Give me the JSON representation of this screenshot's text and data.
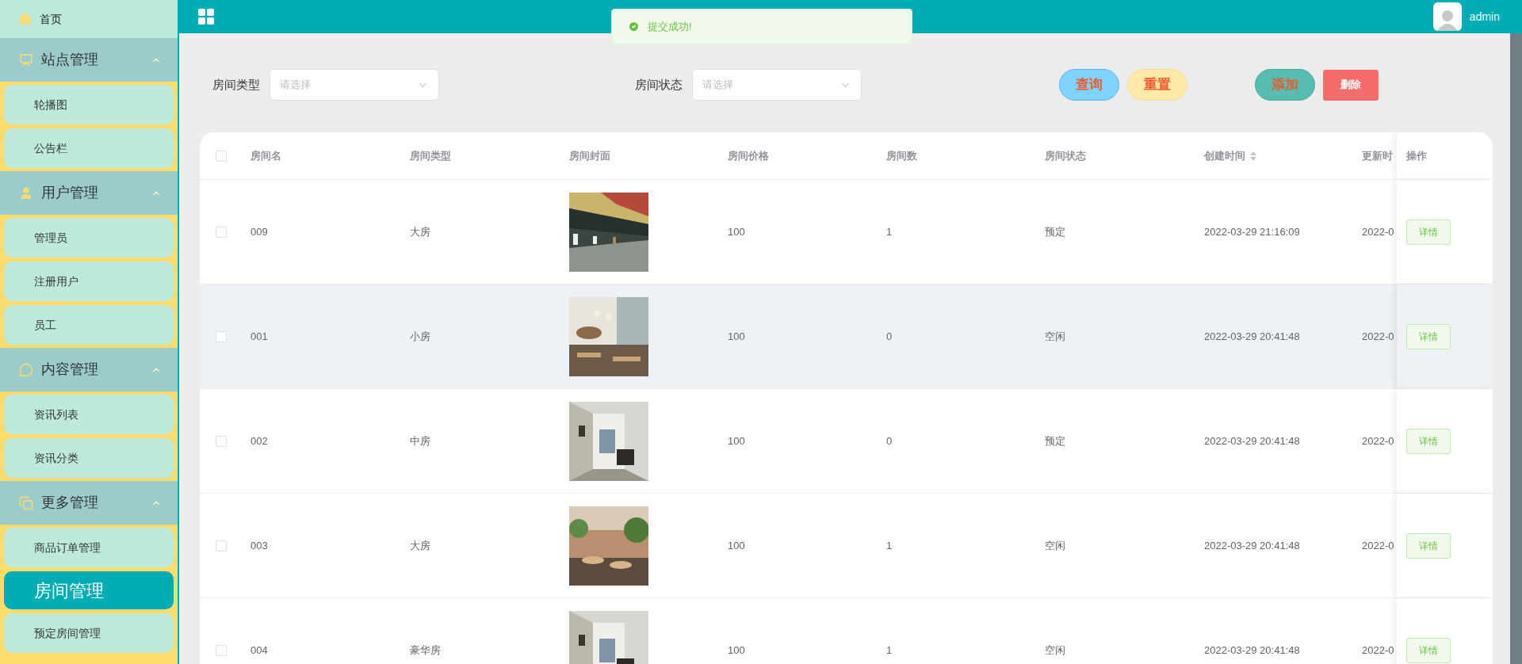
{
  "sidebar": {
    "home": {
      "label": "首页",
      "selected": false
    },
    "groups": [
      {
        "label": "站点管理",
        "expanded": true,
        "items": [
          {
            "label": "轮播图",
            "selected": false
          },
          {
            "label": "公告栏",
            "selected": false
          }
        ]
      },
      {
        "label": "用户管理",
        "expanded": true,
        "items": [
          {
            "label": "管理员",
            "selected": false
          },
          {
            "label": "注册用户",
            "selected": false
          },
          {
            "label": "员工",
            "selected": false
          }
        ]
      },
      {
        "label": "内容管理",
        "expanded": true,
        "items": [
          {
            "label": "资讯列表",
            "selected": false
          },
          {
            "label": "资讯分类",
            "selected": false
          }
        ]
      },
      {
        "label": "更多管理",
        "expanded": true,
        "items": [
          {
            "label": "商品订单管理",
            "selected": false
          },
          {
            "label": "房间管理",
            "selected": true
          },
          {
            "label": "预定房间管理",
            "selected": false
          }
        ]
      }
    ]
  },
  "header": {
    "user": "admin"
  },
  "toast": {
    "message": "提交成功!"
  },
  "filters": [
    {
      "label": "房间类型",
      "placeholder": "请选择"
    },
    {
      "label": "房间状态",
      "placeholder": "请选择"
    }
  ],
  "buttons": [
    {
      "label": "查询",
      "kind": "query"
    },
    {
      "label": "重置",
      "kind": "reset"
    },
    {
      "label": "添加",
      "kind": "add"
    },
    {
      "label": "删除",
      "kind": "delete"
    }
  ],
  "table": {
    "select_all": {
      "checked": false
    },
    "columns": [
      {
        "label": "房间名",
        "sortable": false
      },
      {
        "label": "房间类型",
        "sortable": false
      },
      {
        "label": "房间封面",
        "sortable": false
      },
      {
        "label": "房间价格",
        "sortable": false
      },
      {
        "label": "房间数",
        "sortable": false
      },
      {
        "label": "房间状态",
        "sortable": false
      },
      {
        "label": "创建时间",
        "sortable": true
      },
      {
        "label": "更新时",
        "sortable": false
      }
    ],
    "action_column": "操作",
    "rows": [
      {
        "checked": false,
        "hovered": false,
        "name": "009",
        "type": "大房",
        "price": "100",
        "count": "1",
        "status": "预定",
        "created": "2022-03-29 21:16:09",
        "updated": "2022-0",
        "action": "详情"
      },
      {
        "checked": false,
        "hovered": true,
        "name": "001",
        "type": "小房",
        "price": "100",
        "count": "0",
        "status": "空闲",
        "created": "2022-03-29 20:41:48",
        "updated": "2022-0",
        "action": "详情"
      },
      {
        "checked": false,
        "hovered": false,
        "name": "002",
        "type": "中房",
        "price": "100",
        "count": "0",
        "status": "预定",
        "created": "2022-03-29 20:41:48",
        "updated": "2022-0",
        "action": "详情"
      },
      {
        "checked": false,
        "hovered": false,
        "name": "003",
        "type": "大房",
        "price": "100",
        "count": "1",
        "status": "空闲",
        "created": "2022-03-29 20:41:48",
        "updated": "2022-0",
        "action": "详情"
      },
      {
        "checked": false,
        "hovered": false,
        "name": "004",
        "type": "豪华房",
        "price": "100",
        "count": "1",
        "status": "空闲",
        "created": "2022-03-29 20:41:48",
        "updated": "2022-0",
        "action": "详情"
      }
    ]
  }
}
